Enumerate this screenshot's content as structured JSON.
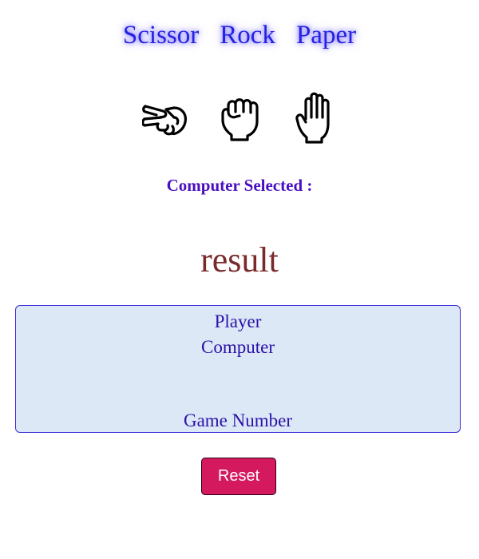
{
  "title": {
    "scissor": "Scissor",
    "rock": "Rock",
    "paper": "Paper"
  },
  "choices": [
    {
      "icon": "scissors-hand-icon"
    },
    {
      "icon": "rock-fist-icon"
    },
    {
      "icon": "paper-hand-icon"
    }
  ],
  "computer_selected_label": "Computer Selected :",
  "result_text": "result",
  "scoreboard": {
    "player_label": "Player",
    "computer_label": "Computer",
    "game_number_label": "Game Number"
  },
  "reset_label": "Reset",
  "colors": {
    "title": "#2323e0",
    "computer_label": "#4a10c0",
    "result": "#7a2a2a",
    "scoreboard_bg": "#dce8f6",
    "reset_bg": "#d5195f"
  }
}
